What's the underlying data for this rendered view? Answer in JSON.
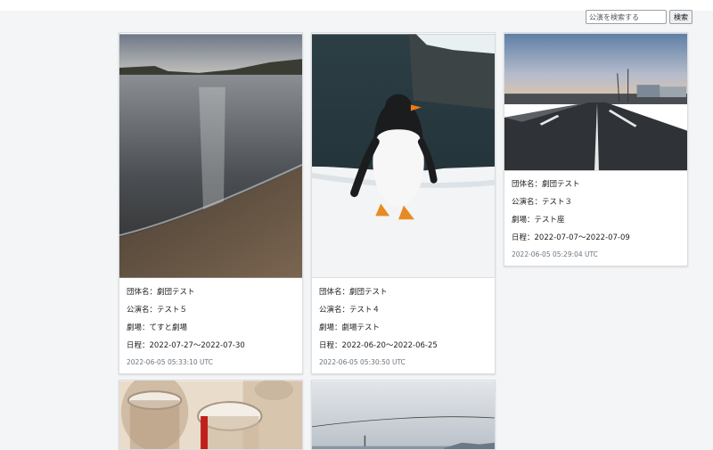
{
  "search": {
    "placeholder": "公演を検索する",
    "button_label": "検索"
  },
  "cards": [
    {
      "troupe": "団体名：劇団テスト",
      "performance": "公演名：テスト５",
      "theater": "劇場：てすと劇場",
      "schedule": "日程：2022-07-27〜2022-07-30",
      "timestamp": "2022-06-05 05:33:10 UTC",
      "photo": "beach-sunset"
    },
    {
      "troupe": "団体名：劇団テスト",
      "performance": "公演名：テスト４",
      "theater": "劇場：劇場テスト",
      "schedule": "日程：2022-06-20〜2022-06-25",
      "timestamp": "2022-06-05 05:30:50 UTC",
      "photo": "penguin-on-snow"
    },
    {
      "troupe": "団体名：劇団テスト",
      "performance": "公演名：テスト３",
      "theater": "劇場：テスト座",
      "schedule": "日程：2022-07-07〜2022-07-09",
      "timestamp": "2022-06-05 05:29:04 UTC",
      "photo": "road-at-dusk"
    },
    {
      "photo": "glasses-on-table"
    },
    {
      "photo": "cloudy-sky-powerlines"
    }
  ]
}
